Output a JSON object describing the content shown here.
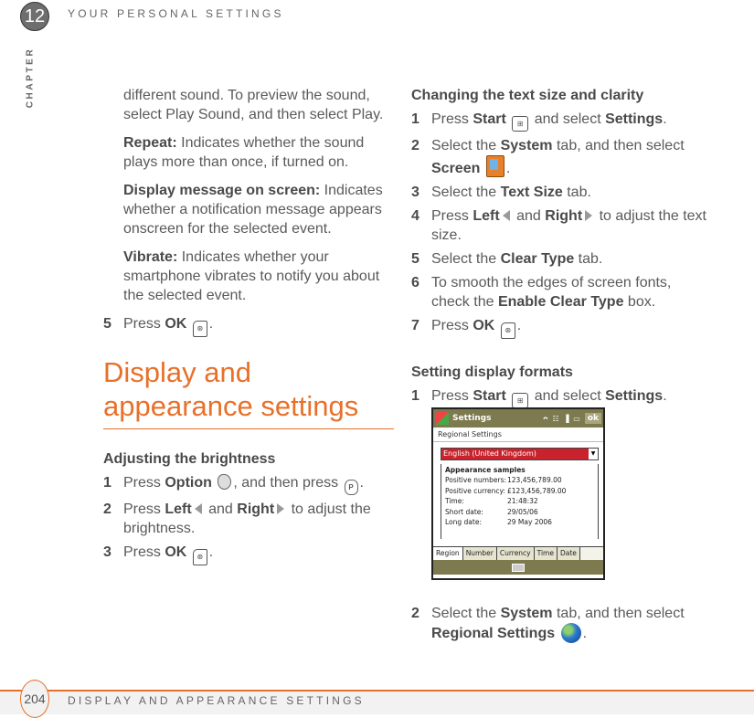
{
  "header": {
    "chapter_number": "12",
    "chapter_label": "CHAPTER",
    "title": "YOUR PERSONAL SETTINGS"
  },
  "footer": {
    "page_number": "204",
    "section": "DISPLAY AND APPEARANCE SETTINGS"
  },
  "accent_color": "#e8702a",
  "left": {
    "intro": "different sound. To preview the sound, select Play Sound, and then select Play.",
    "repeat_term": "Repeat:",
    "repeat_text": " Indicates whether the sound plays more than once, if turned on.",
    "display_term": "Display message on screen:",
    "display_text": " Indicates whether a notification message appears onscreen for the selected event.",
    "vibrate_term": "Vibrate:",
    "vibrate_text": " Indicates whether your smartphone vibrates to notify you about the selected event.",
    "step5_num": "5",
    "step5_press": "Press ",
    "step5_ok": "OK",
    "step5_end": ".",
    "section_title": "Display and appearance settings",
    "brightness": {
      "heading": "Adjusting the brightness",
      "s1_num": "1",
      "s1_a": "Press ",
      "s1_b": "Option",
      "s1_c": ", and then press ",
      "s1_d": ".",
      "s2_num": "2",
      "s2_a": "Press ",
      "s2_b": "Left",
      "s2_c": " and ",
      "s2_d": "Right",
      "s2_e": " to adjust the brightness.",
      "s3_num": "3",
      "s3_a": "Press ",
      "s3_b": "OK",
      "s3_c": "."
    }
  },
  "right": {
    "text_size": {
      "heading": "Changing the text size and clarity",
      "s1_num": "1",
      "s1_a": "Press ",
      "s1_b": "Start",
      "s1_c": " and select ",
      "s1_d": "Settings",
      "s1_e": ".",
      "s2_num": "2",
      "s2_a": "Select the ",
      "s2_b": "System",
      "s2_c": " tab, and then select ",
      "s2_d": "Screen",
      "s2_e": ".",
      "s3_num": "3",
      "s3_a": "Select the ",
      "s3_b": "Text Size",
      "s3_c": " tab.",
      "s4_num": "4",
      "s4_a": "Press ",
      "s4_b": "Left",
      "s4_c": " and ",
      "s4_d": "Right",
      "s4_e": " to adjust the text size.",
      "s5_num": "5",
      "s5_a": "Select the ",
      "s5_b": "Clear Type",
      "s5_c": " tab.",
      "s6_num": "6",
      "s6_a": "To smooth the edges of screen fonts, check the ",
      "s6_b": "Enable Clear Type",
      "s6_c": " box.",
      "s7_num": "7",
      "s7_a": "Press ",
      "s7_b": "OK",
      "s7_c": "."
    },
    "formats": {
      "heading": "Setting display formats",
      "s1_num": "1",
      "s1_a": "Press ",
      "s1_b": "Start",
      "s1_c": " and select ",
      "s1_d": "Settings",
      "s1_e": ".",
      "s2_num": "2",
      "s2_a": "Select the ",
      "s2_b": "System",
      "s2_c": " tab, and then select ",
      "s2_d": "Regional Settings",
      "s2_e": "."
    }
  },
  "phone": {
    "title": "Settings",
    "status_icons": "ᴖ ☷ ▐ ▭",
    "ok_label": "ok",
    "subtitle": "Regional Settings",
    "locale": "English (United Kingdom)",
    "group_title": "Appearance samples",
    "samples": [
      {
        "label": "Positive numbers:",
        "value": "123,456,789.00"
      },
      {
        "label": "Positive currency:",
        "value": "£123,456,789.00"
      },
      {
        "label": "Time:",
        "value": "21:48:32"
      },
      {
        "label": "Short date:",
        "value": "29/05/06"
      },
      {
        "label": "Long date:",
        "value": "29 May 2006"
      }
    ],
    "tabs": [
      "Region",
      "Number",
      "Currency",
      "Time",
      "Date"
    ],
    "active_tab": "Region"
  }
}
